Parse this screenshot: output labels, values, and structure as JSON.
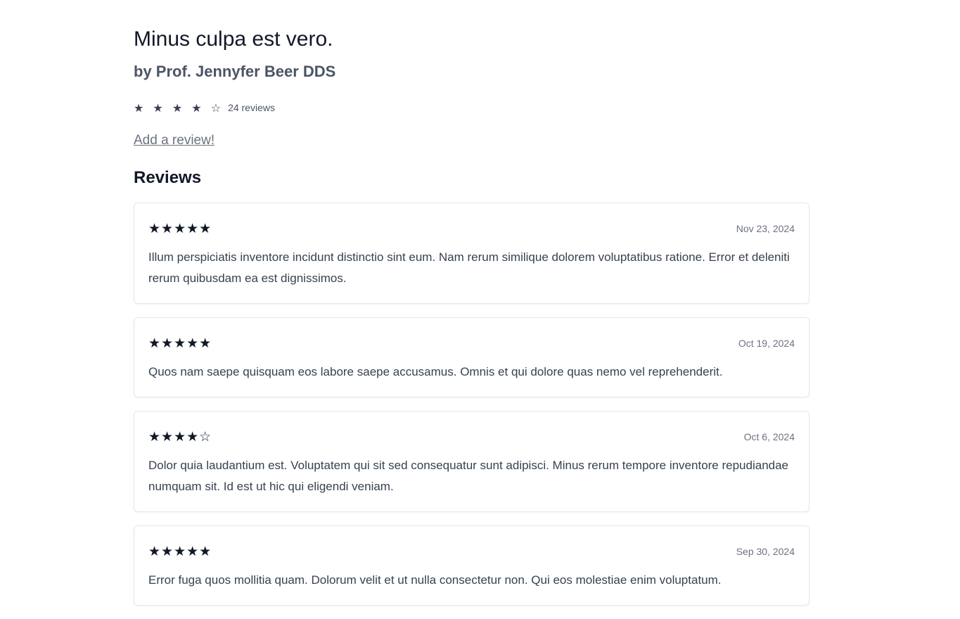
{
  "book": {
    "title": "Minus culpa est vero.",
    "author": "by Prof. Jennyfer Beer DDS",
    "rating_stars": "★ ★ ★ ★ ☆",
    "rating_value": 4,
    "review_count": "24 reviews"
  },
  "actions": {
    "add_review_label": "Add a review!"
  },
  "reviews_section": {
    "heading": "Reviews",
    "items": [
      {
        "stars": "★★★★★",
        "rating": 5,
        "date": "Nov 23, 2024",
        "body": "Illum perspiciatis inventore incidunt distinctio sint eum. Nam rerum similique dolorem voluptatibus ratione. Error et deleniti rerum quibusdam ea est dignissimos."
      },
      {
        "stars": "★★★★★",
        "rating": 5,
        "date": "Oct 19, 2024",
        "body": "Quos nam saepe quisquam eos labore saepe accusamus. Omnis et qui dolore quas nemo vel reprehenderit."
      },
      {
        "stars": "★★★★☆",
        "rating": 4,
        "date": "Oct 6, 2024",
        "body": "Dolor quia laudantium est. Voluptatem qui sit sed consequatur sunt adipisci. Minus rerum tempore inventore repudiandae numquam sit. Id est ut hic qui eligendi veniam."
      },
      {
        "stars": "★★★★★",
        "rating": 5,
        "date": "Sep 30, 2024",
        "body": "Error fuga quos mollitia quam. Dolorum velit et ut nulla consectetur non. Qui eos molestiae enim voluptatum."
      }
    ]
  }
}
